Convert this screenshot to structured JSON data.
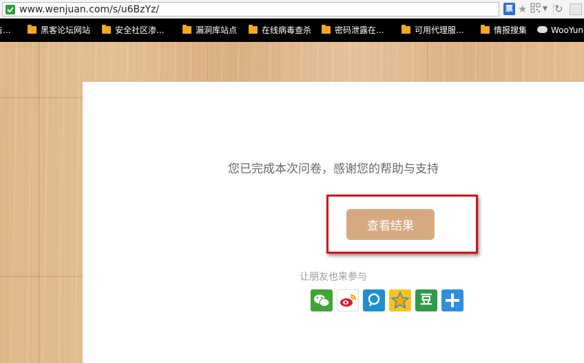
{
  "browser": {
    "url": "www.wenjuan.com/s/u6BzYz/",
    "ticket_icon_label": "票",
    "bookmarks": [
      {
        "label": "告...",
        "icon": "none"
      },
      {
        "label": "黑客论坛网站",
        "icon": "folder-icon"
      },
      {
        "label": "安全社区渗...",
        "icon": "folder-icon"
      },
      {
        "label": "漏洞库站点",
        "icon": "folder-icon"
      },
      {
        "label": "在线病毒查杀",
        "icon": "folder-icon"
      },
      {
        "label": "密码泄露在...",
        "icon": "folder-icon"
      },
      {
        "label": "可用代理服...",
        "icon": "folder-icon"
      },
      {
        "label": "情报搜集",
        "icon": "folder-icon"
      },
      {
        "label": "WooYun",
        "icon": "cloud-icon"
      }
    ]
  },
  "page": {
    "thanks_text": "您已完成本次问卷，感谢您的帮助与支持",
    "result_button": "查看结果",
    "invite_text": "让朋友也来参与",
    "share_icons": [
      "wechat-icon",
      "weibo-icon",
      "tencent-weibo-icon",
      "qzone-icon",
      "douban-icon",
      "more-share-icon"
    ],
    "share_douban_glyph": "豆",
    "colors": {
      "button": "#d6aa80",
      "highlight_border": "#d0141b",
      "wood": "#dfb88c"
    }
  }
}
